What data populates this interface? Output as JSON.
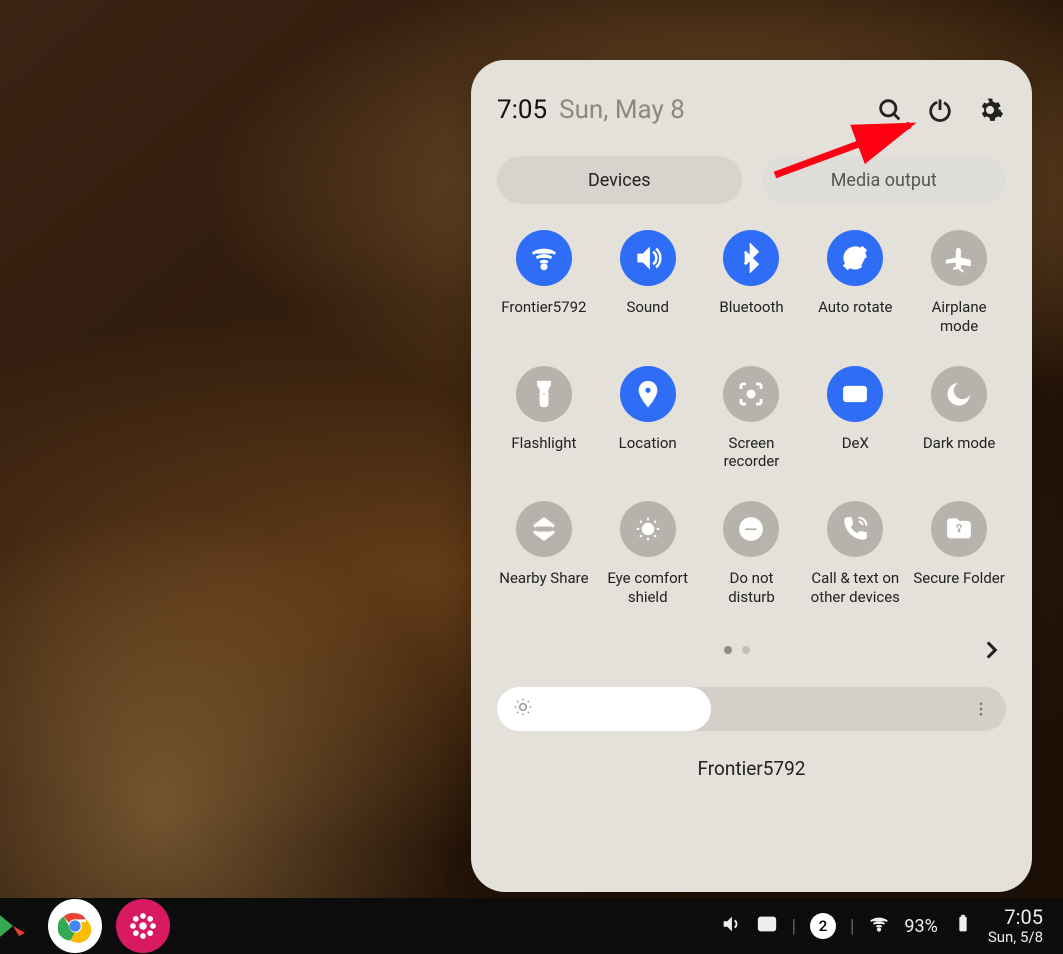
{
  "panel": {
    "time": "7:05",
    "date": "Sun, May 8",
    "tabs": {
      "devices": "Devices",
      "media": "Media output"
    },
    "tiles": [
      {
        "id": "wifi",
        "label": "Frontier5792",
        "active": true,
        "icon": "wifi"
      },
      {
        "id": "sound",
        "label": "Sound",
        "active": true,
        "icon": "volume"
      },
      {
        "id": "bluetooth",
        "label": "Bluetooth",
        "active": true,
        "icon": "bluetooth"
      },
      {
        "id": "autorotate",
        "label": "Auto rotate",
        "active": true,
        "icon": "rotate"
      },
      {
        "id": "airplane",
        "label": "Airplane mode",
        "active": false,
        "icon": "plane"
      },
      {
        "id": "flashlight",
        "label": "Flashlight",
        "active": false,
        "icon": "flashlight"
      },
      {
        "id": "location",
        "label": "Location",
        "active": true,
        "icon": "location"
      },
      {
        "id": "screenrec",
        "label": "Screen recorder",
        "active": false,
        "icon": "screenrec"
      },
      {
        "id": "dex",
        "label": "DeX",
        "active": true,
        "icon": "dex"
      },
      {
        "id": "darkmode",
        "label": "Dark mode",
        "active": false,
        "icon": "moon"
      },
      {
        "id": "nearby",
        "label": "Nearby Share",
        "active": false,
        "icon": "nearby"
      },
      {
        "id": "eyecomfort",
        "label": "Eye comfort shield",
        "active": false,
        "icon": "eye"
      },
      {
        "id": "dnd",
        "label": "Do not disturb",
        "active": false,
        "icon": "dnd"
      },
      {
        "id": "calltext",
        "label": "Call & text on other devices",
        "active": false,
        "icon": "calltext"
      },
      {
        "id": "securefolder",
        "label": "Secure Folder",
        "active": false,
        "icon": "folder"
      }
    ],
    "pager": {
      "current": 1,
      "total": 2
    },
    "brightness_pct": 42,
    "network": "Frontier5792"
  },
  "taskbar": {
    "apps": [
      {
        "id": "playstore",
        "name": "Play Store"
      },
      {
        "id": "chrome",
        "name": "Chrome"
      },
      {
        "id": "gallery",
        "name": "Gallery"
      }
    ],
    "notif_count": "2",
    "battery": "93%",
    "clock_time": "7:05",
    "clock_date": "Sun, 5/8"
  },
  "colors": {
    "accent": "#2f6df6",
    "tile_off": "#b7b3ac",
    "panel_bg": "#e4e0da"
  }
}
